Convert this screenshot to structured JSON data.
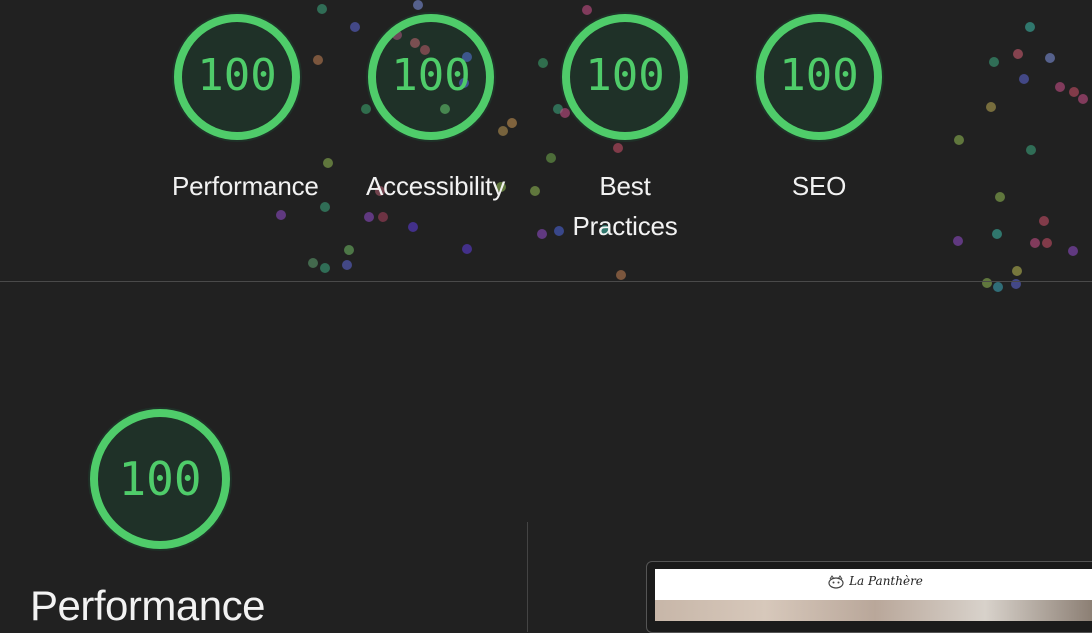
{
  "categories": [
    {
      "label": "Performance",
      "score": "100"
    },
    {
      "label": "Accessibility",
      "score": "100"
    },
    {
      "label": "Best Practices",
      "score": "100"
    },
    {
      "label": "SEO",
      "score": "100"
    }
  ],
  "performance_section": {
    "score": "100",
    "title": "Performance"
  },
  "screenshot_preview": {
    "brand": "La Panthère"
  },
  "colors": {
    "background": "#212121",
    "pass_green": "#4fcc6a",
    "text": "#f2f2f2"
  },
  "icons": [
    "panther-logo-icon"
  ]
}
